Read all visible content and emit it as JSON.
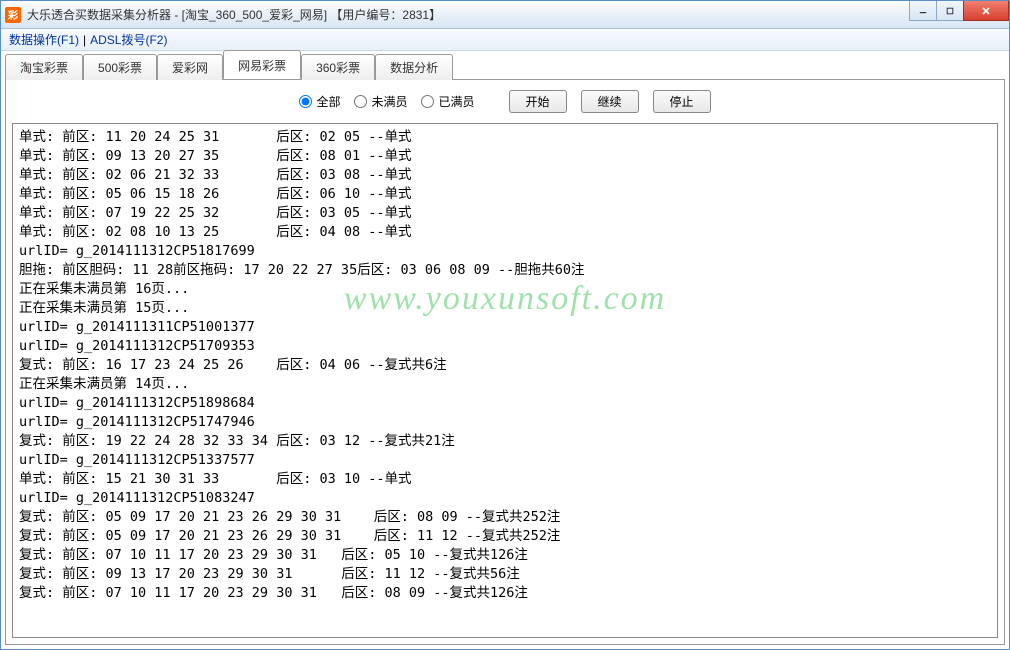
{
  "window": {
    "icon_glyph": "彩",
    "title": "大乐透合买数据采集分析器 - [淘宝_360_500_爱彩_网易]        【用户编号：2831】"
  },
  "menu": {
    "item1": "数据操作(F1)",
    "sep": " | ",
    "item2": "ADSL拨号(F2)"
  },
  "tabs": [
    {
      "label": "淘宝彩票",
      "active": false
    },
    {
      "label": "500彩票",
      "active": false
    },
    {
      "label": "爱彩网",
      "active": false
    },
    {
      "label": "网易彩票",
      "active": true
    },
    {
      "label": "360彩票",
      "active": false
    },
    {
      "label": "数据分析",
      "active": false
    }
  ],
  "radios": {
    "all": "全部",
    "notfull": "未满员",
    "full": "已满员",
    "selected": "all"
  },
  "buttons": {
    "start": "开始",
    "continue": "继续",
    "stop": "停止"
  },
  "watermark": "www.youxunsoft.com",
  "log_lines": [
    "单式: 前区: 11 20 24 25 31       后区: 02 05 --单式",
    "单式: 前区: 09 13 20 27 35       后区: 08 01 --单式",
    "单式: 前区: 02 06 21 32 33       后区: 03 08 --单式",
    "单式: 前区: 05 06 15 18 26       后区: 06 10 --单式",
    "单式: 前区: 07 19 22 25 32       后区: 03 05 --单式",
    "单式: 前区: 02 08 10 13 25       后区: 04 08 --单式",
    "urlID= g_2014111312CP51817699",
    "胆拖: 前区胆码: 11 28前区拖码: 17 20 22 27 35后区: 03 06 08 09 --胆拖共60注",
    "正在采集未满员第 16页...",
    "正在采集未满员第 15页...",
    "urlID= g_2014111311CP51001377",
    "urlID= g_2014111312CP51709353",
    "复式: 前区: 16 17 23 24 25 26    后区: 04 06 --复式共6注",
    "正在采集未满员第 14页...",
    "urlID= g_2014111312CP51898684",
    "urlID= g_2014111312CP51747946",
    "复式: 前区: 19 22 24 28 32 33 34 后区: 03 12 --复式共21注",
    "urlID= g_2014111312CP51337577",
    "单式: 前区: 15 21 30 31 33       后区: 03 10 --单式",
    "urlID= g_2014111312CP51083247",
    "复式: 前区: 05 09 17 20 21 23 26 29 30 31    后区: 08 09 --复式共252注",
    "复式: 前区: 05 09 17 20 21 23 26 29 30 31    后区: 11 12 --复式共252注",
    "复式: 前区: 07 10 11 17 20 23 29 30 31   后区: 05 10 --复式共126注",
    "复式: 前区: 09 13 17 20 23 29 30 31      后区: 11 12 --复式共56注",
    "复式: 前区: 07 10 11 17 20 23 29 30 31   后区: 08 09 --复式共126注"
  ]
}
